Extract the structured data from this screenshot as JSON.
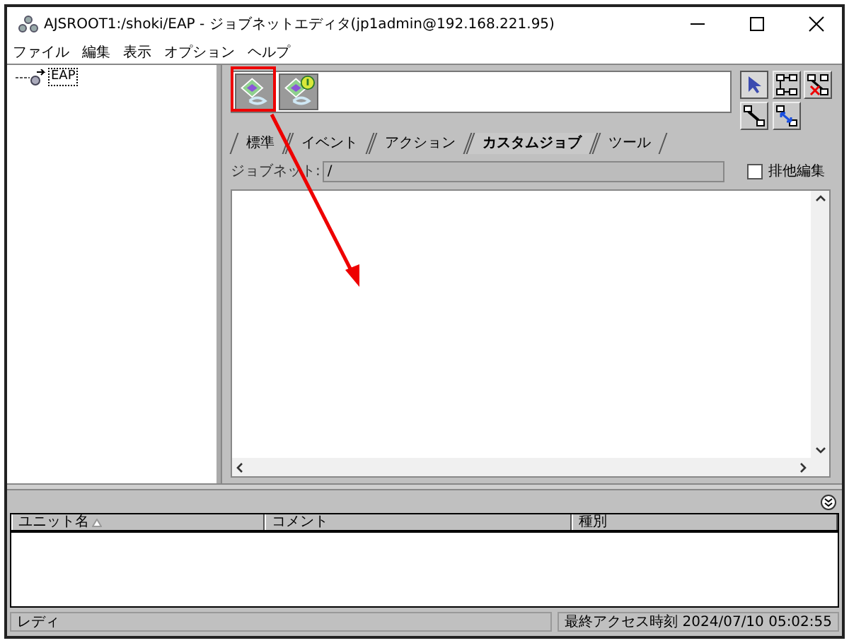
{
  "window": {
    "title": "AJSROOT1:/shoki/EAP - ジョブネットエディタ(jp1admin@192.168.221.95)"
  },
  "menu": [
    "ファイル",
    "編集",
    "表示",
    "オプション",
    "ヘルプ"
  ],
  "tree": [
    {
      "label": "EAP",
      "selected": true
    }
  ],
  "tools": [
    {
      "kind": "pointer",
      "selected": true
    },
    {
      "kind": "connect",
      "selected": false
    },
    {
      "kind": "disconnect",
      "selected": false
    },
    {
      "kind": "branch",
      "selected": false
    },
    {
      "kind": "reroute",
      "selected": false
    }
  ],
  "tabs": [
    {
      "label": "標準",
      "selected": false
    },
    {
      "label": "イベント",
      "selected": false
    },
    {
      "label": "アクション",
      "selected": false
    },
    {
      "label": "カスタムジョブ",
      "selected": true
    },
    {
      "label": "ツール",
      "selected": false
    }
  ],
  "jobnet": {
    "label": "ジョブネット:",
    "value": "/"
  },
  "exclusive_edit": {
    "label": "排他編集",
    "checked": false
  },
  "table": {
    "columns": [
      {
        "label": "ユニット名",
        "sorted": true
      },
      {
        "label": "コメント",
        "sorted": false
      },
      {
        "label": "種別",
        "sorted": false
      }
    ]
  },
  "status_bar": {
    "message": "レディ",
    "last_access": "最終アクセス時刻 2024/07/10 05:02:55"
  }
}
